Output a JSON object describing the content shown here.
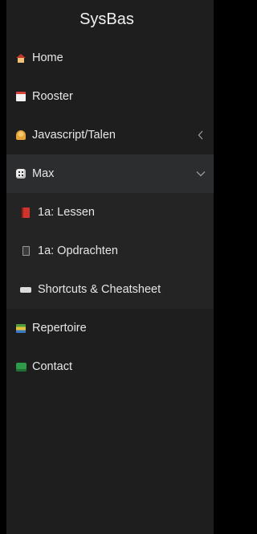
{
  "app": {
    "title": "SysBas"
  },
  "nav": {
    "items": [
      {
        "label": "Home",
        "icon": "house-icon"
      },
      {
        "label": "Rooster",
        "icon": "calendar-icon"
      },
      {
        "label": "Javascript/Talen",
        "icon": "person-icon",
        "chevron": "chevron-left-icon"
      },
      {
        "label": "Max",
        "icon": "die-icon",
        "chevron": "chevron-down-icon",
        "expanded": true,
        "children": [
          {
            "label": "1a: Lessen",
            "icon": "red-book-icon"
          },
          {
            "label": "1a: Opdrachten",
            "icon": "notebook-icon"
          },
          {
            "label": "Shortcuts & Cheatsheet",
            "icon": "keyboard-icon"
          }
        ]
      },
      {
        "label": "Repertoire",
        "icon": "books-icon"
      },
      {
        "label": "Contact",
        "icon": "contact-icon"
      }
    ]
  },
  "colors": {
    "sidebar_bg": "#1e1e1e",
    "active_bg": "#2b2d2e",
    "submenu_bg": "#242424",
    "text": "#e6e6e6"
  }
}
